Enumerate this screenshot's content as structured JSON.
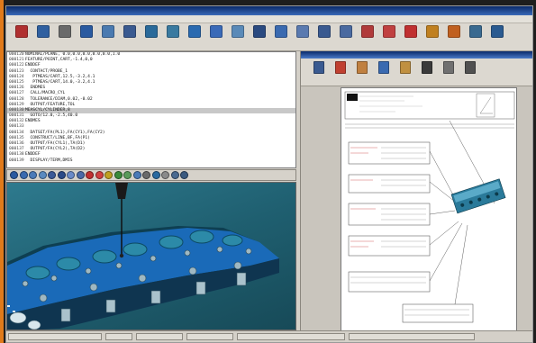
{
  "toolbar": {
    "buttons": [
      {
        "icon": "pencil-icon",
        "color": "#b03030"
      },
      {
        "icon": "wrench-icon",
        "color": "#3060a0"
      },
      {
        "icon": "gear-icon",
        "color": "#6a6a6a"
      },
      {
        "icon": "arrow-icon",
        "color": "#2a5aa0"
      },
      {
        "icon": "cross-icon",
        "color": "#4a7ab0"
      },
      {
        "icon": "probe-icon",
        "color": "#3a5a90"
      },
      {
        "icon": "plane-icon",
        "color": "#2a6a9a"
      },
      {
        "icon": "circle-icon",
        "color": "#3a7aa0"
      },
      {
        "icon": "cylinder-icon",
        "color": "#2a6ab0"
      },
      {
        "icon": "cone-icon",
        "color": "#3a6ab8"
      },
      {
        "icon": "line-icon",
        "color": "#5a8ab8"
      },
      {
        "icon": "point-icon",
        "color": "#2a4a80"
      },
      {
        "icon": "sphere-icon",
        "color": "#3a6ab0"
      },
      {
        "icon": "slot-icon",
        "color": "#5a7ab0"
      },
      {
        "icon": "curve-icon",
        "color": "#3a5a90"
      },
      {
        "icon": "surface-icon",
        "color": "#4a6aa0"
      },
      {
        "icon": "distance-icon",
        "color": "#b03a3a"
      },
      {
        "icon": "angle-icon",
        "color": "#c04040"
      },
      {
        "icon": "tolerance-icon",
        "color": "#c03030"
      },
      {
        "icon": "report-icon",
        "color": "#c08020"
      },
      {
        "icon": "scan-icon",
        "color": "#c06020"
      },
      {
        "icon": "export-icon",
        "color": "#3a6a90"
      },
      {
        "icon": "help-icon",
        "color": "#2a5a90"
      }
    ]
  },
  "editor": {
    "lines": [
      {
        "ln": "000120",
        "text": "NOMINAL/PLANE, 0.0,0.0,0.0,0.0,0.0,1.0",
        "sel": false
      },
      {
        "ln": "000121",
        "text": "FEATURE/POINT,CART,-1.4,0,0",
        "sel": false
      },
      {
        "ln": "000122",
        "text": "ENDDEF",
        "sel": false
      },
      {
        "ln": "000123",
        "text": "  CONTACT/PROBE_1",
        "sel": false
      },
      {
        "ln": "000124",
        "text": "   PTMEAS/CART,12.5,-3.2,4.1",
        "sel": false
      },
      {
        "ln": "000125",
        "text": "   PTMEAS/CART,14.0,-3.2,4.1",
        "sel": false
      },
      {
        "ln": "000126",
        "text": "  ENDMES",
        "sel": false
      },
      {
        "ln": "000127",
        "text": "  CALL/MACRO_CYL",
        "sel": false
      },
      {
        "ln": "000128",
        "text": "  TOLERANCE/DIAM,0.02,-0.02",
        "sel": false
      },
      {
        "ln": "000129",
        "text": "  OUTPUT/FEATURE,TOL",
        "sel": false
      },
      {
        "ln": "000130",
        "text": "MEASCYL/CYLINDER,8",
        "sel": true
      },
      {
        "ln": "000131",
        "text": "  GOTO/12.0,-2.5,40.0",
        "sel": false
      },
      {
        "ln": "000132",
        "text": "ENDMES",
        "sel": false
      },
      {
        "ln": "000133",
        "text": "",
        "sel": false
      },
      {
        "ln": "000134",
        "text": "  DATSET/FA(PL1),FA(CY1),FA(CY2)",
        "sel": false
      },
      {
        "ln": "000135",
        "text": "  CONSTRUCT/LINE,BF,FA(P1)",
        "sel": false
      },
      {
        "ln": "000136",
        "text": "  OUTPUT/FA(CYL1),TA(D1)",
        "sel": false
      },
      {
        "ln": "000137",
        "text": "  OUTPUT/FA(CYL2),TA(D2)",
        "sel": false
      },
      {
        "ln": "000138",
        "text": "ENDDEF",
        "sel": false
      },
      {
        "ln": "000139",
        "text": "  DISPLAY/TERM,DMIS",
        "sel": false
      }
    ]
  },
  "view_tools": {
    "colors": [
      "#2a5aa0",
      "#3a6ab0",
      "#4a7ab8",
      "#5a8ac0",
      "#3a5a98",
      "#2a4a88",
      "#6a8ac8",
      "#4a6aa8",
      "#c03030",
      "#d04040",
      "#c0a020",
      "#3a8a3a",
      "#5a9a5a",
      "#4a7ab8",
      "#6a6a6a",
      "#2a6aa0",
      "#8a8a8a",
      "#4a6a90",
      "#3a5a80"
    ]
  },
  "report_panel": {
    "tool_icons": [
      "printer-icon",
      "page-icon",
      "picture-icon",
      "table-icon",
      "folder-icon",
      "chart-icon",
      "binoculars-icon",
      "zoom-icon"
    ],
    "tool_colors": [
      "#3a5a90",
      "#c04030",
      "#c08040",
      "#3a6ab0",
      "#c09040",
      "#3a3a3a",
      "#707070",
      "#505050"
    ]
  },
  "status": {
    "fields": [
      "",
      "",
      "",
      "",
      "",
      ""
    ]
  }
}
